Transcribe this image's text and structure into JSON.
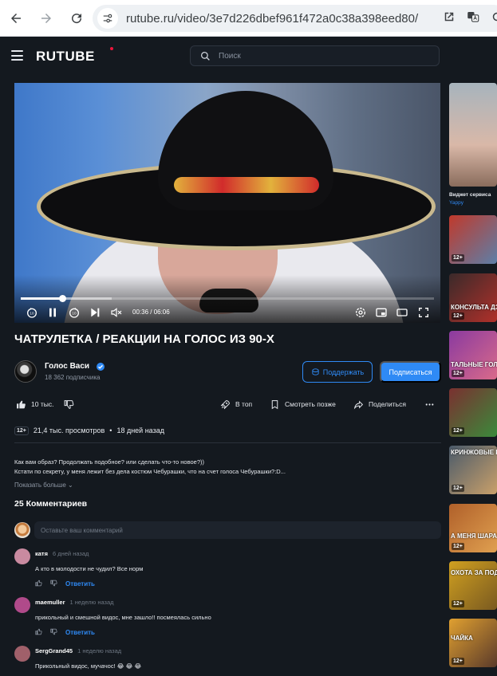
{
  "browser": {
    "url": "rutube.ru/video/3e7d226dbef961f472a0c38a398eed80/"
  },
  "site": {
    "logo": "RUTUBE",
    "search_placeholder": "Поиск"
  },
  "player": {
    "time": "00:36 / 06:06",
    "progress": 0.1,
    "buffered": 0.22
  },
  "video": {
    "title": "ЧАТРУЛЕТКА / РЕАКЦИИ НА ГОЛОС ИЗ 90-Х",
    "channel_name": "Голос Васи",
    "subscribers": "18 362 подписчика",
    "support_label": "Поддержать",
    "subscribe_label": "Подписаться",
    "likes": "10 тыс.",
    "top_label": "В топ",
    "watch_later_label": "Смотреть позже",
    "share_label": "Поделиться",
    "age": "12+",
    "views": "21,4 тыс. просмотров",
    "published": "18 дней назад",
    "description_line1": "Как вам образ? Продолжать подобное? или сделать что-то новое?))",
    "description_line2": "Кстати по секрету, у меня лежит без дела костюм Чебурашки, что на счет голоса Чебурашки?:D...",
    "show_more": "Показать больше"
  },
  "comments": {
    "title": "25 Комментариев",
    "input_placeholder": "Оставьте ваш комментарий",
    "reply_label": "Ответить",
    "items": [
      {
        "author": "катя",
        "time": "6 дней назад",
        "text": "А кто в молодости не чудил? Все норм",
        "avatar_color": "#c98aa0"
      },
      {
        "author": "maemuller",
        "time": "1 неделю назад",
        "text": "прикольный и смешной видос, мне зашло!! посмеялась сильно",
        "avatar_color": "#b04a8a"
      },
      {
        "author": "SergGrand45",
        "time": "1 неделю назад",
        "text": "Прикольный видос, мучачос! 😂 😂 😂",
        "avatar_color": "#a0606a"
      }
    ]
  },
  "rail": {
    "widget_title": "Виджет сервиса",
    "widget_sub": "Yappy",
    "age": "12+",
    "captions": [
      "КОНСУЛЬТА ДЭДПУЛ",
      "ТАЛЬНЫЕ ГОЛОС",
      "КРИНЖОВЫЕ РАЗГОВОРЫ",
      "А МЕНЯ ШАРАЗНЕ",
      "ОХОТА ЗА ПОД",
      "ЧАЙКА"
    ]
  },
  "colors": {
    "accent": "#2f8af5",
    "brand_dot": "#ed143b",
    "background": "#14191f"
  }
}
